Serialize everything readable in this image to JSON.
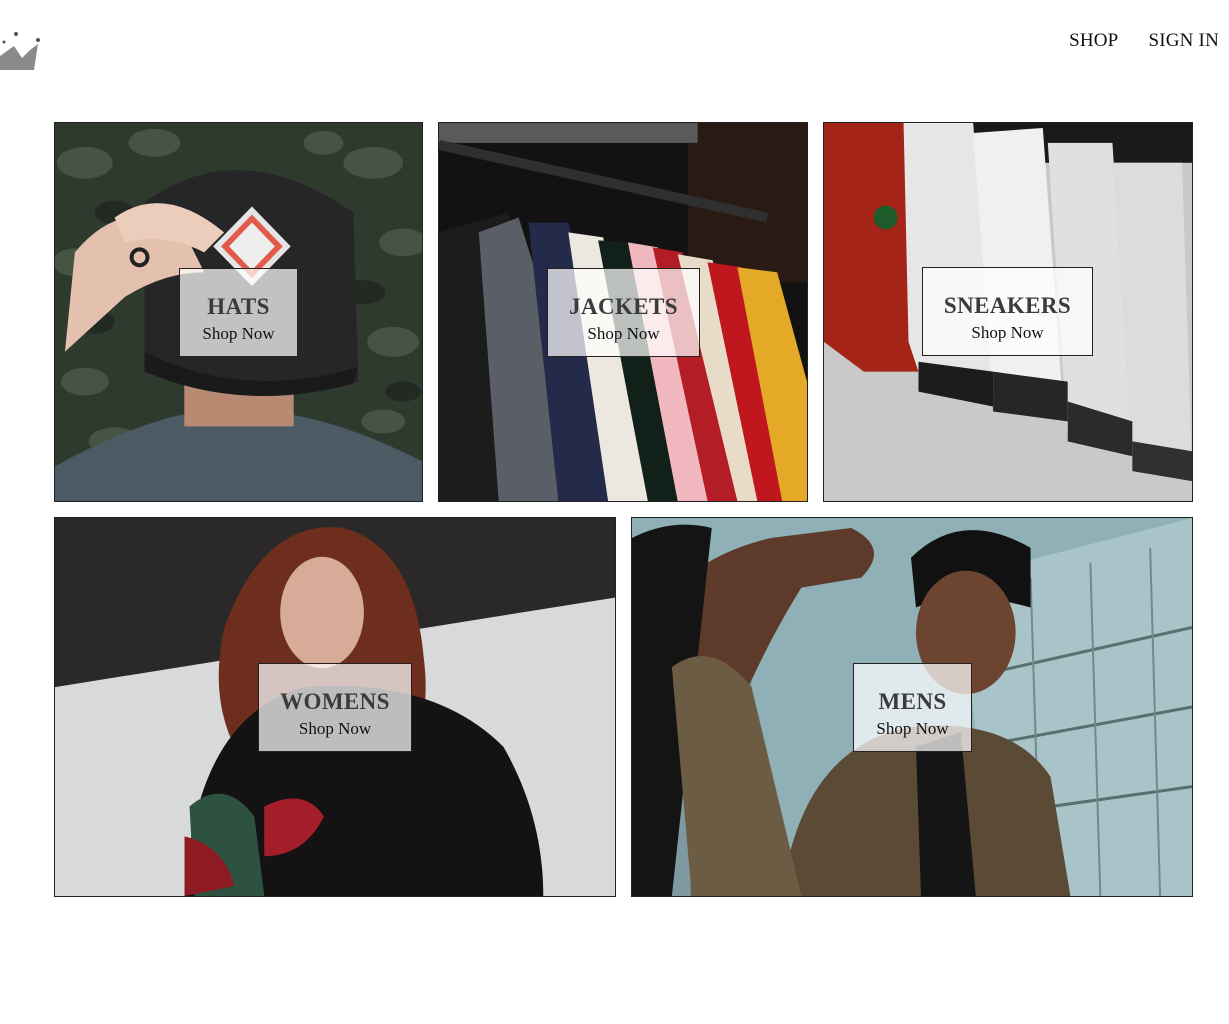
{
  "header": {
    "logo_icon": "crown-icon",
    "nav": [
      {
        "label": "SHOP"
      },
      {
        "label": "SIGN IN"
      }
    ]
  },
  "directory": [
    {
      "title": "HATS",
      "subtitle": "Shop Now",
      "image": "man in black cap seen from behind"
    },
    {
      "title": "JACKETS",
      "subtitle": "Shop Now",
      "image": "clothing rack with jackets"
    },
    {
      "title": "SNEAKERS",
      "subtitle": "Shop Now",
      "image": "row of sneakers"
    },
    {
      "title": "WOMENS",
      "subtitle": "Shop Now",
      "image": "woman with long red hair in black top"
    },
    {
      "title": "MENS",
      "subtitle": "Shop Now",
      "image": "man reaching toward camera in camo jacket"
    }
  ]
}
